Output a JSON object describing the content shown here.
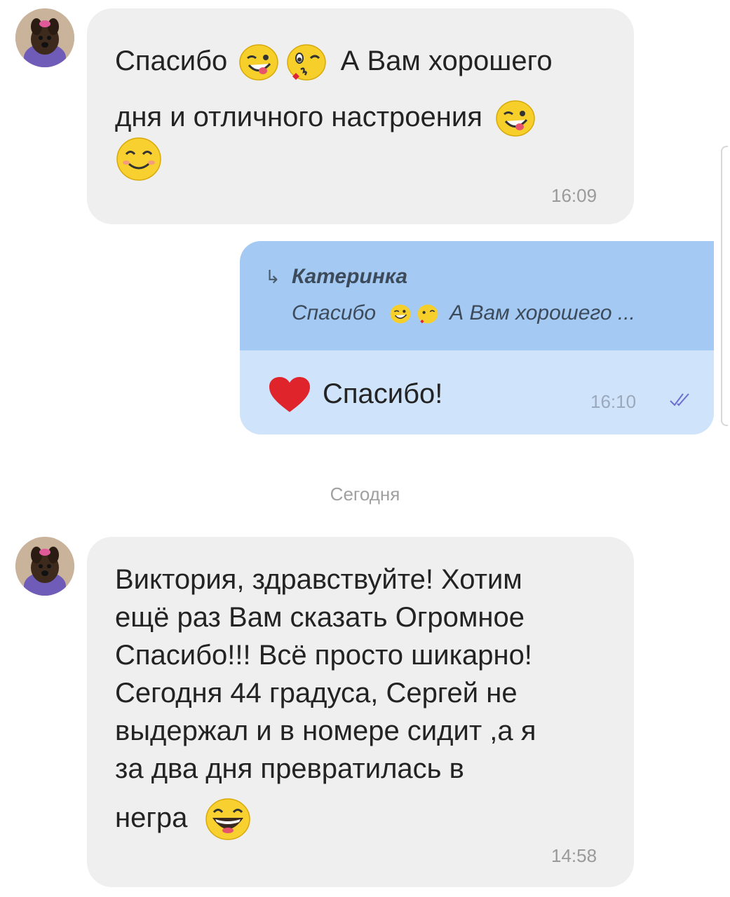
{
  "messages": {
    "first": {
      "line1_a": "Спасибо",
      "line1_b": "А Вам хорошего",
      "line2": "дня и отличного настроения",
      "time": "16:09"
    },
    "outgoing": {
      "reply_author": "Катеринка",
      "reply_preview_a": "Спасибо",
      "reply_preview_b": "А Вам хорошего ...",
      "text": "Спасибо!",
      "time": "16:10"
    },
    "date_separator": "Сегодня",
    "second": {
      "line1": "Виктория, здравствуйте! Хотим",
      "line2": "ещё раз Вам сказать Огромное",
      "line3": "Спасибо!!! Всё просто шикарно!",
      "line4": "Сегодня 44 градуса, Сергей не",
      "line5": "выдержал и в номере сидит ,а я",
      "line6": "за два дня превратилась в",
      "line7": "негра",
      "time": "14:58"
    }
  },
  "icons": {
    "avatar": "dog-photo-avatar",
    "wink_emoji": "winking-tongue-face-emoji",
    "kiss_emoji": "kissing-face-emoji",
    "smile_emoji": "smiling-face-emoji",
    "laugh_emoji": "laughing-face-emoji",
    "heart": "red-heart-icon",
    "reply": "reply-arrow-icon",
    "read": "double-check-icon"
  },
  "colors": {
    "incoming_bubble": "#efefef",
    "outgoing_bubble": "#cfe3fb",
    "reply_block": "#a4c9f3",
    "heart": "#e0242c",
    "read_check": "#6a6fd0"
  }
}
